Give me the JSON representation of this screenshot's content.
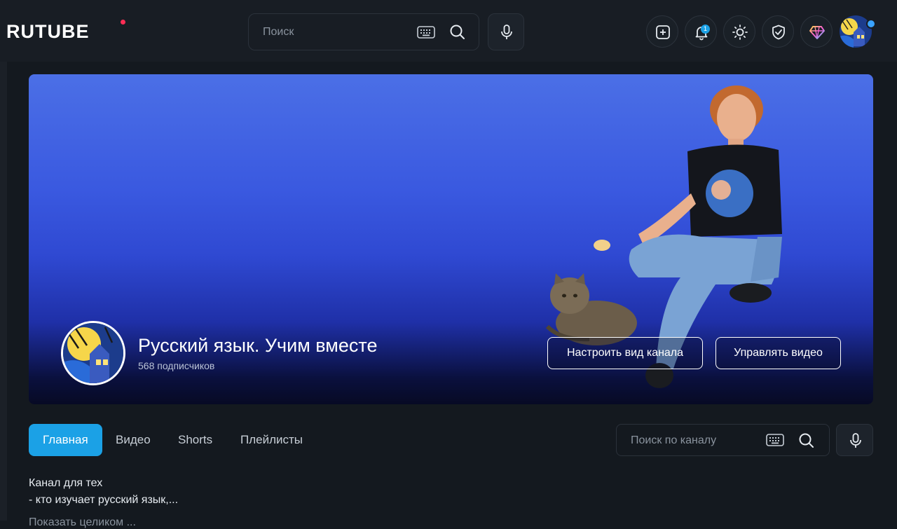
{
  "header": {
    "logo_text": "RUTUBE",
    "search_placeholder": "Поиск",
    "notifications_count": "1"
  },
  "channel": {
    "title": "Русский язык. Учим вместе",
    "subscribers": "568 подписчиков",
    "customize_label": "Настроить вид канала",
    "manage_videos_label": "Управлять видео"
  },
  "tabs": [
    {
      "label": "Главная",
      "active": true
    },
    {
      "label": "Видео",
      "active": false
    },
    {
      "label": "Shorts",
      "active": false
    },
    {
      "label": "Плейлисты",
      "active": false
    }
  ],
  "channel_search_placeholder": "Поиск по каналу",
  "description": {
    "line1": "Канал для тех",
    "line2": "- кто изучает русский язык,...",
    "show_all": "Показать целиком ..."
  },
  "colors": {
    "accent": "#1ba1e6",
    "logo_dot": "#ff2d55",
    "background": "#14191f"
  },
  "icons": [
    "keyboard-icon",
    "search-icon",
    "microphone-icon",
    "add-icon",
    "bell-icon",
    "sun-icon",
    "shield-check-icon",
    "diamond-icon"
  ]
}
